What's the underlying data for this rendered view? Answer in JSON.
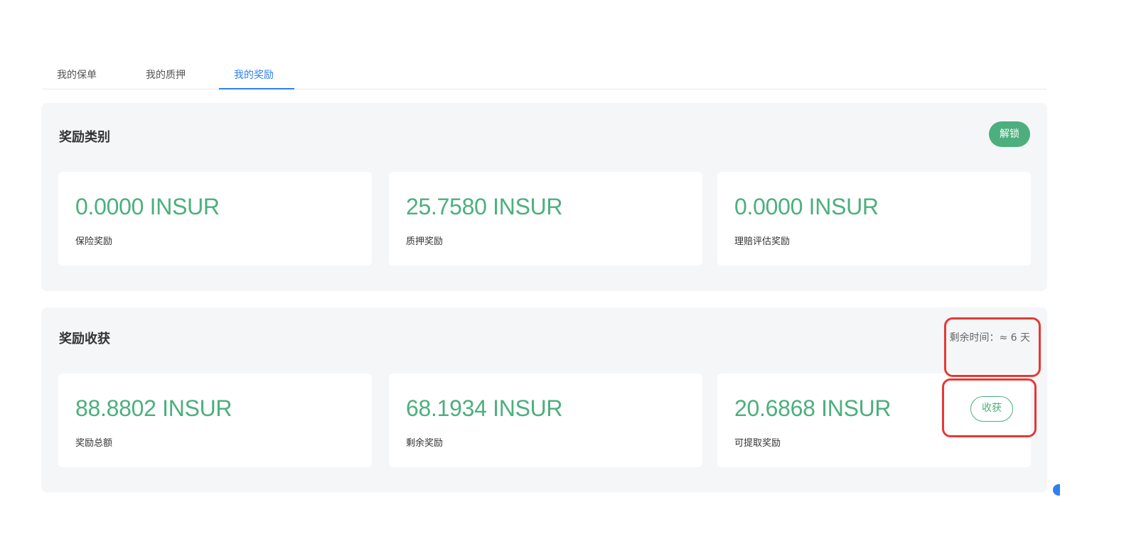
{
  "tabs": [
    {
      "label": "我的保单",
      "active": false
    },
    {
      "label": "我的质押",
      "active": false
    },
    {
      "label": "我的奖励",
      "active": true
    }
  ],
  "categories": {
    "title": "奖励类别",
    "unlock_label": "解锁",
    "cards": [
      {
        "amount": "0.0000 INSUR",
        "label": "保险奖励"
      },
      {
        "amount": "25.7580 INSUR",
        "label": "质押奖励"
      },
      {
        "amount": "0.0000 INSUR",
        "label": "理赔评估奖励"
      }
    ]
  },
  "harvest": {
    "title": "奖励收获",
    "remaining_time": "剩余时间：≈ 6 天",
    "harvest_label": "收获",
    "cards": [
      {
        "amount": "88.8802 INSUR",
        "label": "奖励总额"
      },
      {
        "amount": "68.1934 INSUR",
        "label": "剩余奖励"
      },
      {
        "amount": "20.6868 INSUR",
        "label": "可提取奖励"
      }
    ]
  },
  "colors": {
    "accent_green": "#4caf7d",
    "tab_active_blue": "#2f80ed",
    "panel_bg": "#f5f6f8",
    "highlight_red": "#e53935"
  }
}
